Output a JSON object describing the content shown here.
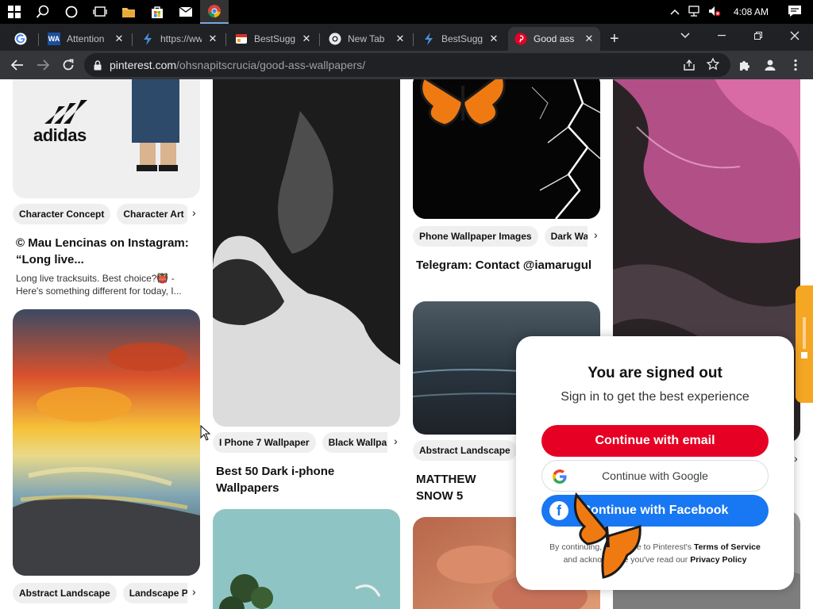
{
  "taskbar": {
    "clock": "4:08 AM",
    "icons": [
      "windows-start-icon",
      "search-icon",
      "cortana-icon",
      "task-view-icon",
      "file-explorer-icon",
      "store-icon",
      "mail-icon",
      "chrome-icon"
    ]
  },
  "tabs": [
    {
      "title": "",
      "favicon": "google"
    },
    {
      "title": "Attention",
      "favicon": "wa"
    },
    {
      "title": "https://ww",
      "favicon": "bolt"
    },
    {
      "title": "BestSugge",
      "favicon": "bestsugg"
    },
    {
      "title": "New Tab",
      "favicon": "chrome"
    },
    {
      "title": "BestSugge",
      "favicon": "bolt"
    },
    {
      "title": "Good ass",
      "favicon": "pinterest",
      "active": true
    }
  ],
  "address": {
    "host": "pinterest.com",
    "path": "/ohsnapitscrucia/good-ass-wallpapers/"
  },
  "pins": {
    "col1_top": {
      "brand": "adidas",
      "chips": [
        "Character Concept",
        "Character Art"
      ],
      "title": "© Mau Lencinas on Instagram: “Long live...",
      "desc": "Long live tracksuits. Best choice?👹 - Here's something different for today, I..."
    },
    "col1_bottom": {
      "chips": [
        "Abstract Landscape",
        "Landscape Pai"
      ]
    },
    "col2_top": {
      "chips": [
        "I Phone 7 Wallpaper",
        "Black Wallpap"
      ],
      "title": "Best 50 Dark i-phone Wallpapers"
    },
    "col3_top": {
      "chips": [
        "Phone Wallpaper Images",
        "Dark Wal"
      ],
      "title": "Telegram: Contact @iamarugul"
    },
    "col3_mid": {
      "chips": [
        "Abstract Landscape"
      ],
      "title": "MATTHEW SNOW 5"
    }
  },
  "modal": {
    "heading": "You are signed out",
    "subheading": "Sign in to get the best experience",
    "email_button": "Continue with email",
    "google_button": "Continue with Google",
    "facebook_button": "Continue with Facebook",
    "legal_prefix": "By continuing, you agree to Pinterest's",
    "terms": "Terms of Service",
    "legal_mid": "and acknowledge you've read our",
    "privacy": "Privacy Policy"
  },
  "colors": {
    "pinterest_red": "#e60023",
    "facebook_blue": "#1877f2",
    "chrome_dark": "#202124"
  }
}
